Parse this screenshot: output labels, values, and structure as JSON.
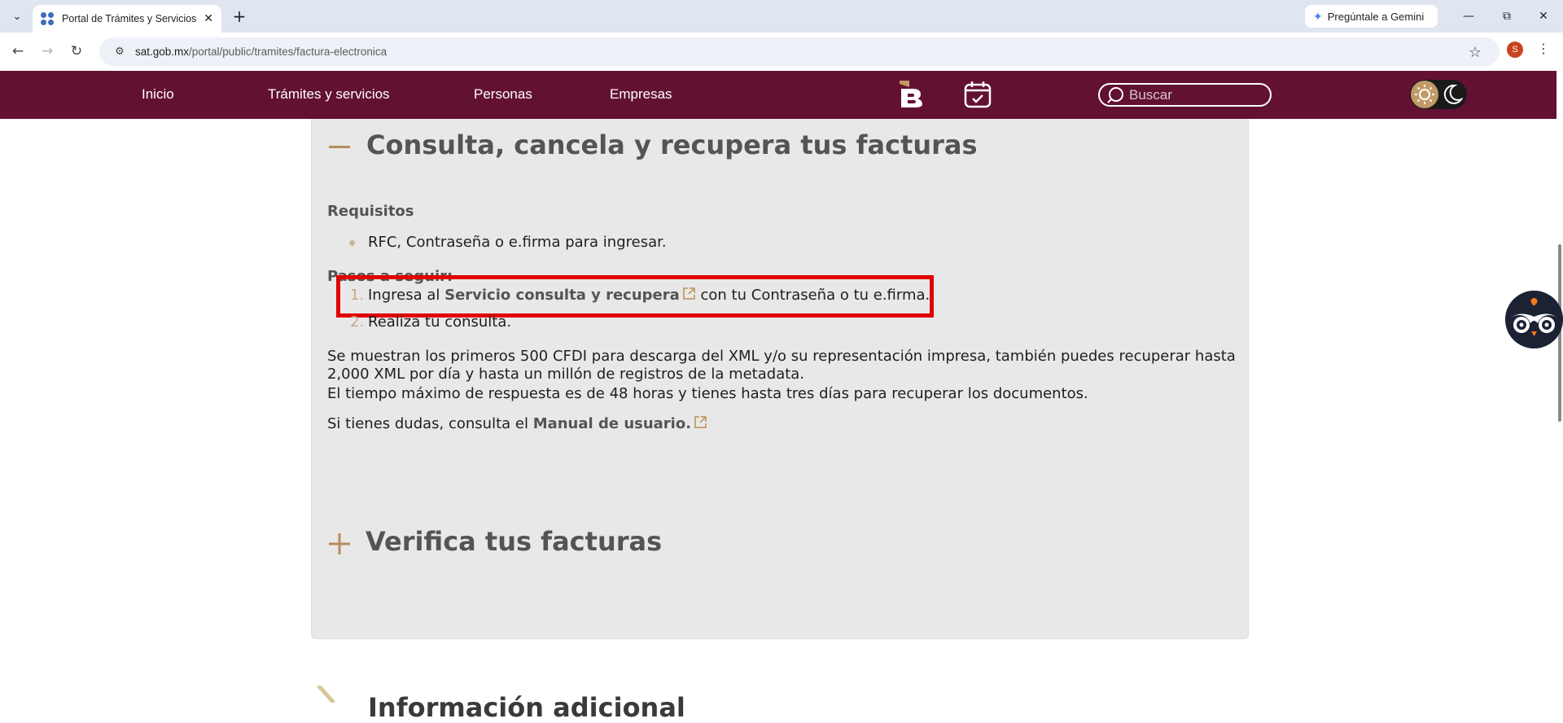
{
  "browser": {
    "tab_title": "Portal de Trámites y Servicios d",
    "new_tab": "+",
    "gemini_label": "Pregúntale a Gemini",
    "url_host": "sat.gob.mx",
    "url_path": "/portal/public/tramites/factura-electronica",
    "profile_initial": "S"
  },
  "header": {
    "nav": [
      "Inicio",
      "Trámites y servicios",
      "Personas",
      "Empresas"
    ],
    "search_placeholder": "Buscar",
    "color": "#621132"
  },
  "accordion_open": {
    "title": "Consulta, cancela y recupera tus facturas",
    "requisitos_heading": "Requisitos",
    "requisitos_item": "RFC, Contraseña o e.firma para ingresar.",
    "pasos_heading": "Pasos a seguir:",
    "step1_num": "1.",
    "step1_pre": "Ingresa al ",
    "step1_link": "Servicio consulta y recupera",
    "step1_post": " con tu Contraseña o tu e.firma.",
    "step2_num": "2.",
    "step2_text": "Realiza tu consulta.",
    "para1": "Se muestran los primeros 500 CFDI para descarga del XML y/o su representación impresa, también puedes recuperar hasta 2,000 XML por día y hasta un millón de registros de la metadata.",
    "para2": "El tiempo máximo de respuesta es de 48 horas y tienes hasta tres días para recuperar los documentos.",
    "para3_pre": "Si tienes dudas, consulta el ",
    "para3_link": "Manual de usuario."
  },
  "accordion_closed": {
    "title": "Verifica tus facturas"
  },
  "below_section": {
    "title": "Información adicional"
  },
  "colors": {
    "gold": "#b38e5d",
    "highlight": "#e00000"
  }
}
